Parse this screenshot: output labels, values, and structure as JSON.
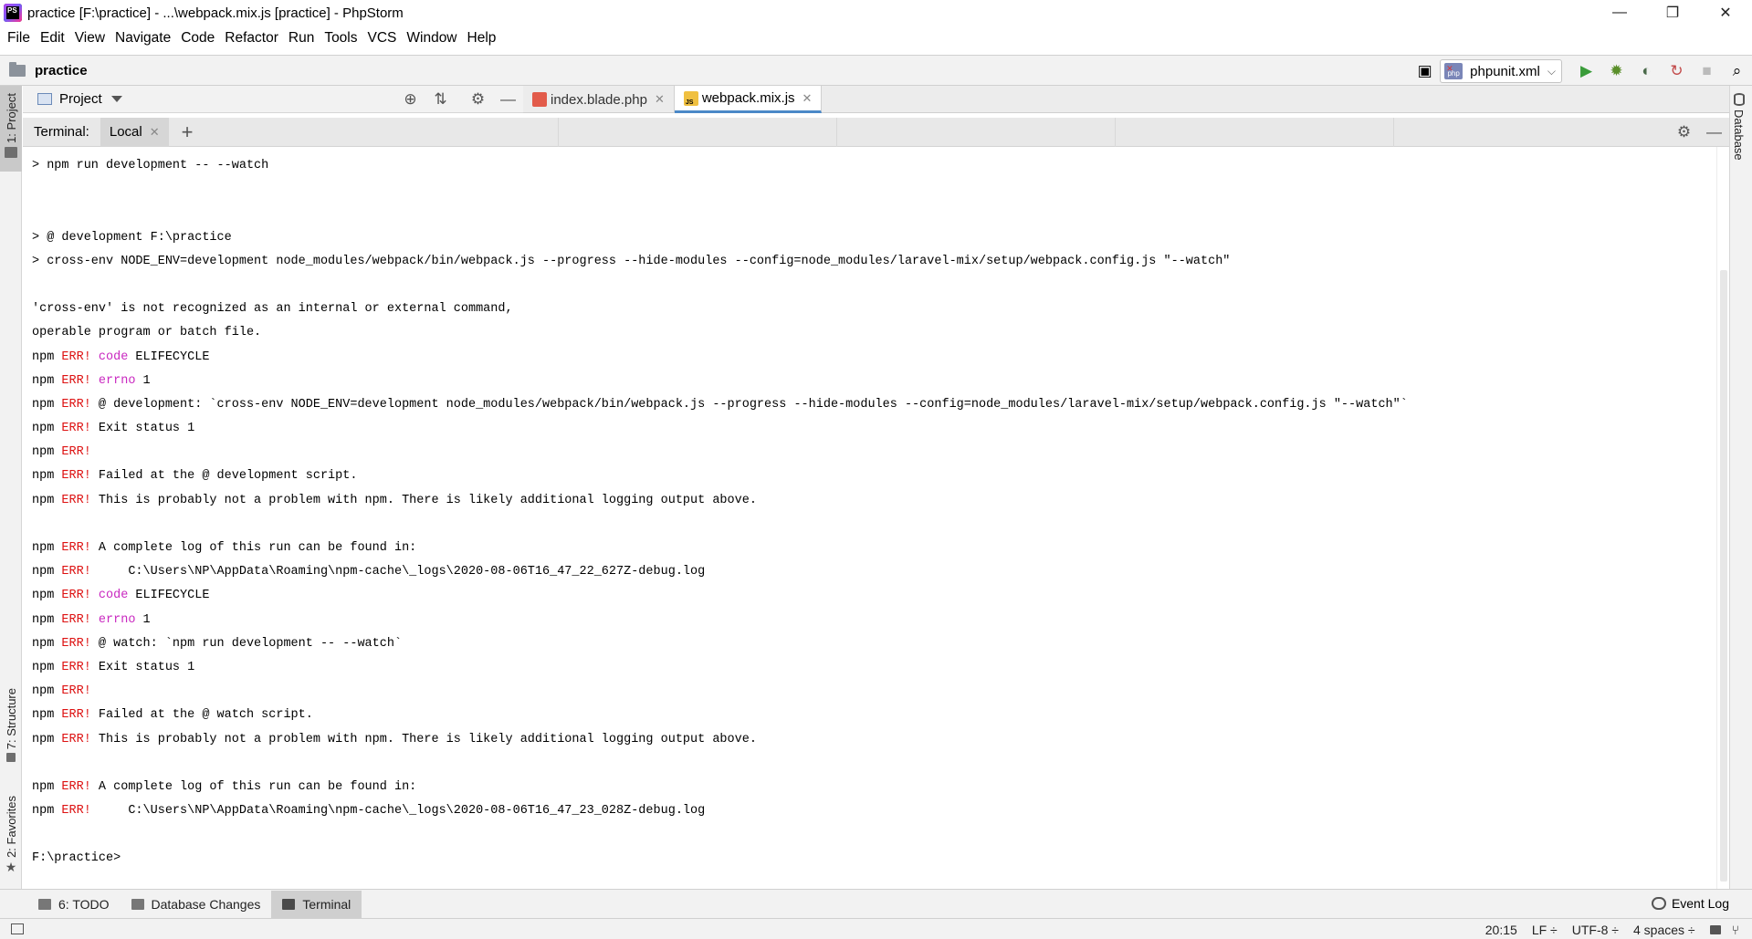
{
  "window": {
    "title": "practice [F:\\practice] - ...\\webpack.mix.js [practice] - PhpStorm",
    "app_icon_text": "PS",
    "controls": {
      "minimize": "—",
      "restore": "❐",
      "close": "✕"
    }
  },
  "menu": [
    "File",
    "Edit",
    "View",
    "Navigate",
    "Code",
    "Refactor",
    "Run",
    "Tools",
    "VCS",
    "Window",
    "Help"
  ],
  "navbar": {
    "project_name": "practice",
    "run_config": "phpunit.xml",
    "icons": [
      "run-icon",
      "debug-icon",
      "coverage-icon",
      "profile-icon",
      "stop-icon",
      "search-everywhere-icon"
    ]
  },
  "left_strip": {
    "project_tab": "1: Project",
    "structure_tab": "7: Structure",
    "favorites_tab": "2: Favorites"
  },
  "right_strip": {
    "database_tab": "Database"
  },
  "project_pane": {
    "title": "Project"
  },
  "editor_tabs": [
    {
      "label": "index.blade.php",
      "active": false
    },
    {
      "label": "webpack.mix.js",
      "active": true
    }
  ],
  "terminal": {
    "label": "Terminal:",
    "session_tab": "Local",
    "new_session": "+",
    "lines": [
      [
        {
          "t": "> npm run development -- --watch"
        }
      ],
      [],
      [],
      [
        {
          "t": "> @ development F:\\practice"
        }
      ],
      [
        {
          "t": "> cross-env NODE_ENV=development node_modules/webpack/bin/webpack.js --progress --hide-modules --config=node_modules/laravel-mix/setup/webpack.config.js \"--watch\""
        }
      ],
      [],
      [
        {
          "t": "'cross-env' is not recognized as an internal or external command,"
        }
      ],
      [
        {
          "t": "operable program or batch file."
        }
      ],
      [
        {
          "t": "npm "
        },
        {
          "t": "ERR!",
          "c": "err"
        },
        {
          "t": " "
        },
        {
          "t": "code",
          "c": "kw"
        },
        {
          "t": " ELIFECYCLE"
        }
      ],
      [
        {
          "t": "npm "
        },
        {
          "t": "ERR!",
          "c": "err"
        },
        {
          "t": " "
        },
        {
          "t": "errno",
          "c": "kw"
        },
        {
          "t": " 1"
        }
      ],
      [
        {
          "t": "npm "
        },
        {
          "t": "ERR!",
          "c": "err"
        },
        {
          "t": " @ development: `cross-env NODE_ENV=development node_modules/webpack/bin/webpack.js --progress --hide-modules --config=node_modules/laravel-mix/setup/webpack.config.js \"--watch\"`"
        }
      ],
      [
        {
          "t": "npm "
        },
        {
          "t": "ERR!",
          "c": "err"
        },
        {
          "t": " Exit status 1"
        }
      ],
      [
        {
          "t": "npm "
        },
        {
          "t": "ERR!",
          "c": "err"
        }
      ],
      [
        {
          "t": "npm "
        },
        {
          "t": "ERR!",
          "c": "err"
        },
        {
          "t": " Failed at the @ development script."
        }
      ],
      [
        {
          "t": "npm "
        },
        {
          "t": "ERR!",
          "c": "err"
        },
        {
          "t": " This is probably not a problem with npm. There is likely additional logging output above."
        }
      ],
      [],
      [
        {
          "t": "npm "
        },
        {
          "t": "ERR!",
          "c": "err"
        },
        {
          "t": " A complete log of this run can be found in:"
        }
      ],
      [
        {
          "t": "npm "
        },
        {
          "t": "ERR!",
          "c": "err"
        },
        {
          "t": "     C:\\Users\\NP\\AppData\\Roaming\\npm-cache\\_logs\\2020-08-06T16_47_22_627Z-debug.log"
        }
      ],
      [
        {
          "t": "npm "
        },
        {
          "t": "ERR!",
          "c": "err"
        },
        {
          "t": " "
        },
        {
          "t": "code",
          "c": "kw"
        },
        {
          "t": " ELIFECYCLE"
        }
      ],
      [
        {
          "t": "npm "
        },
        {
          "t": "ERR!",
          "c": "err"
        },
        {
          "t": " "
        },
        {
          "t": "errno",
          "c": "kw"
        },
        {
          "t": " 1"
        }
      ],
      [
        {
          "t": "npm "
        },
        {
          "t": "ERR!",
          "c": "err"
        },
        {
          "t": " @ watch: `npm run development -- --watch`"
        }
      ],
      [
        {
          "t": "npm "
        },
        {
          "t": "ERR!",
          "c": "err"
        },
        {
          "t": " Exit status 1"
        }
      ],
      [
        {
          "t": "npm "
        },
        {
          "t": "ERR!",
          "c": "err"
        }
      ],
      [
        {
          "t": "npm "
        },
        {
          "t": "ERR!",
          "c": "err"
        },
        {
          "t": " Failed at the @ watch script."
        }
      ],
      [
        {
          "t": "npm "
        },
        {
          "t": "ERR!",
          "c": "err"
        },
        {
          "t": " This is probably not a problem with npm. There is likely additional logging output above."
        }
      ],
      [],
      [
        {
          "t": "npm "
        },
        {
          "t": "ERR!",
          "c": "err"
        },
        {
          "t": " A complete log of this run can be found in:"
        }
      ],
      [
        {
          "t": "npm "
        },
        {
          "t": "ERR!",
          "c": "err"
        },
        {
          "t": "     C:\\Users\\NP\\AppData\\Roaming\\npm-cache\\_logs\\2020-08-06T16_47_23_028Z-debug.log"
        }
      ],
      [],
      [
        {
          "t": "F:\\practice>"
        }
      ]
    ]
  },
  "bottom_bar": {
    "todo": "6: TODO",
    "database_changes": "Database Changes",
    "terminal": "Terminal",
    "event_log": "Event Log"
  },
  "status_bar": {
    "position": "20:15",
    "line_separator": "LF ÷",
    "encoding": "UTF-8 ÷",
    "indent": "4 spaces ÷"
  },
  "colors": {
    "error": "#dd1111",
    "keyword": "#c928c0",
    "active_tab_underline": "#4a88c7"
  }
}
